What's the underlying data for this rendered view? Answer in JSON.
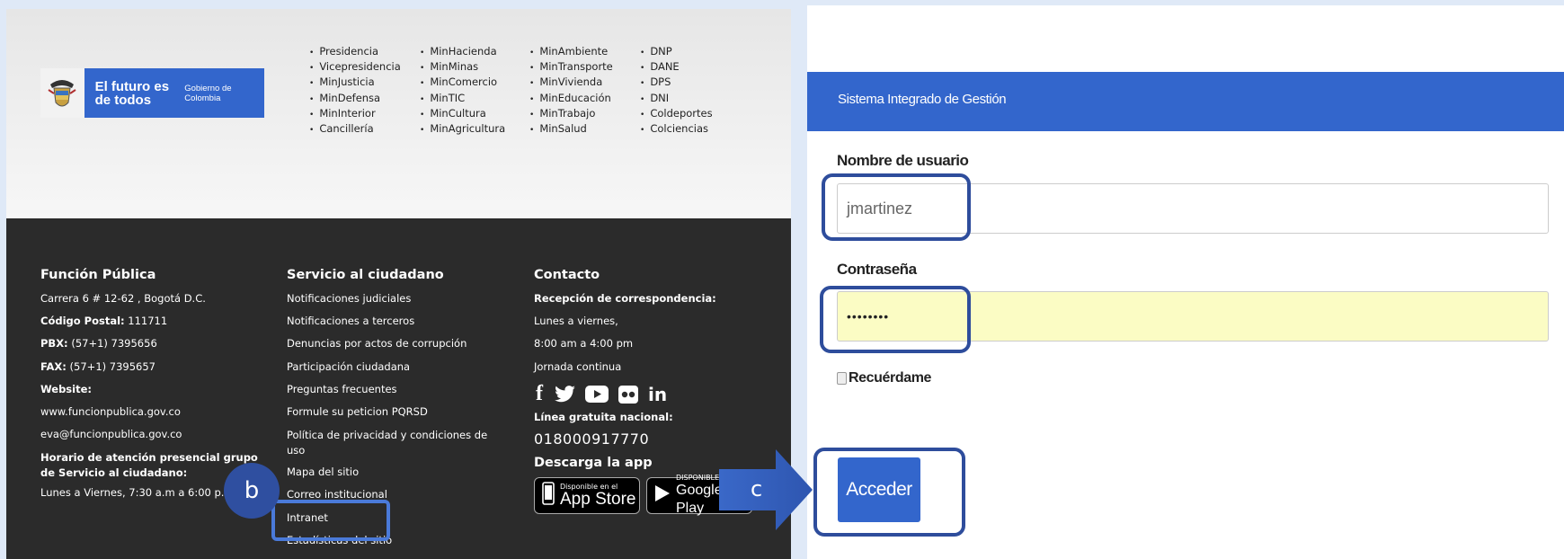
{
  "gov_logo": {
    "slogan": "El futuro es de todos",
    "sub": "Gobierno de Colombia"
  },
  "ministries": {
    "col1": [
      "Presidencia",
      "Vicepresidencia",
      "MinJusticia",
      "MinDefensa",
      "MinInterior",
      "Cancillería"
    ],
    "col2": [
      "MinHacienda",
      "MinMinas",
      "MinComercio",
      "MinTIC",
      "MinCultura",
      "MinAgricultura"
    ],
    "col3": [
      "MinAmbiente",
      "MinTransporte",
      "MinVivienda",
      "MinEducación",
      "MinTrabajo",
      "MinSalud"
    ],
    "col4": [
      "DNP",
      "DANE",
      "DPS",
      "DNI",
      "Coldeportes",
      "Colciencias"
    ]
  },
  "footer": {
    "funcion": {
      "title": "Función Pública",
      "address": "Carrera 6 # 12-62 , Bogotá D.C.",
      "postal_label": "Código Postal:",
      "postal": " 111711",
      "pbx_label": "PBX:",
      "pbx": " (57+1) 7395656",
      "fax_label": "FAX:",
      "fax": " (57+1) 7395657",
      "website_label": "Website:",
      "website": "www.funcionpublica.gov.co",
      "email": "eva@funcionpublica.gov.co",
      "hours_label": "Horario de atención presencial grupo de Servicio al ciudadano:",
      "hours": "Lunes a Viernes, 7:30 a.m a 6:00 p.m"
    },
    "servicio": {
      "title": "Servicio al ciudadano",
      "links": [
        "Notificaciones judiciales",
        "Notificaciones a terceros",
        "Denuncias por actos de corrupción",
        "Participación ciudadana",
        "Preguntas frecuentes",
        "Formule su peticion PQRSD",
        "Política de privacidad y condiciones de uso",
        "Mapa del sitio",
        "Correo institucional",
        "Intranet",
        "Estadísticas del sitio"
      ]
    },
    "contacto": {
      "title": "Contacto",
      "reception_label": "Recepción de correspondencia:",
      "days": "Lunes a viernes,",
      "hours": "8:00 am a 4:00 pm",
      "shift": "Jornada continua",
      "toll_free_label": "Línea gratuita nacional:",
      "toll_free": "018000917770",
      "app_label": "Descarga la app",
      "appstore_small": "Disponible en el",
      "appstore_big": "App Store",
      "google_small": "DISPONIBLE EN",
      "google_big": "Google Play"
    }
  },
  "login": {
    "bar_title": "Sistema Integrado de Gestión",
    "username_label": "Nombre de usuario",
    "username_value": "jmartinez",
    "password_label": "Contraseña",
    "password_value": "••••••••",
    "remember_label": "Recuérdame",
    "submit_label": "Acceder"
  },
  "annotations": {
    "b": "b",
    "c": "c",
    "highlight_color": "#2e4d9c"
  }
}
